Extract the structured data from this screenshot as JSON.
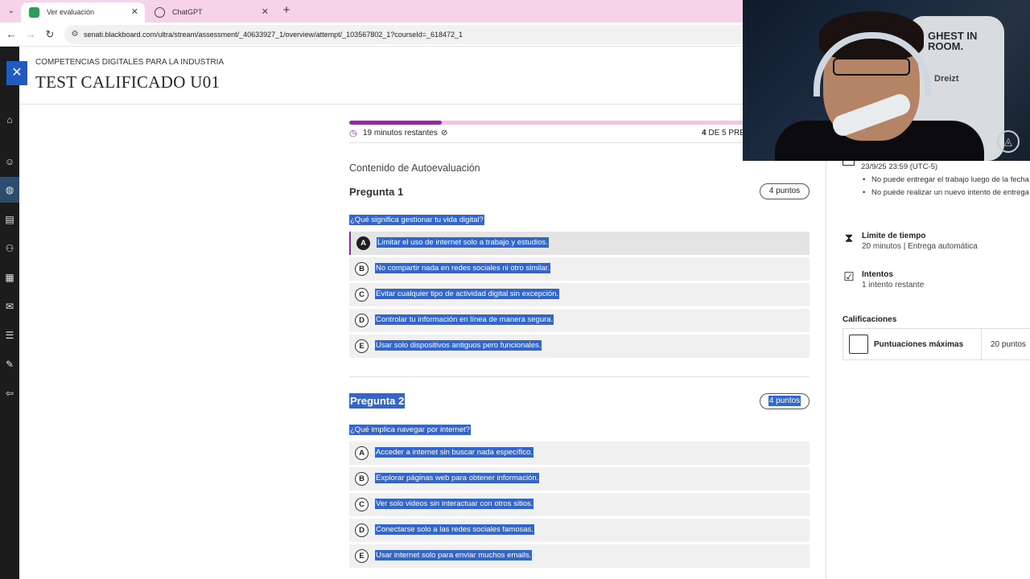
{
  "browser": {
    "tabs": [
      {
        "label": "Ver evaluación",
        "active": true,
        "icon": "blackboard-icon",
        "color": "#2e9c5a"
      },
      {
        "label": "ChatGPT",
        "active": false,
        "icon": "chatgpt-icon",
        "color": "#444444"
      }
    ],
    "url": "senati.blackboard.com/ultra/stream/assessment/_40633927_1/overview/attempt/_103567802_1?courseId=_618472_1"
  },
  "header": {
    "course": "COMPETENCIAS DIGITALES PARA LA INDUSTRIA",
    "title": "TEST CALIFICADO U01"
  },
  "progress": {
    "fraction": 0.225,
    "timer": "19 minutos restantes",
    "current": "4",
    "count_text": " DE 5 PREG"
  },
  "content": {
    "section_title": "Contenido de Autoevaluación",
    "questions": [
      {
        "heading": "Pregunta 1",
        "points": "4 puntos",
        "text": "¿Qué significa gestionar tu vida digital?",
        "options": [
          {
            "letter": "A",
            "text": "Limitar el uso de internet solo a trabajo y estudios."
          },
          {
            "letter": "B",
            "text": "No compartir nada en redes sociales ni otro similar."
          },
          {
            "letter": "C",
            "text": "Evitar cualquier tipo de actividad digital sin excepción."
          },
          {
            "letter": "D",
            "text": "Controlar tu información en línea de manera segura."
          },
          {
            "letter": "E",
            "text": "Usar solo dispositivos antiguos pero funcionales."
          }
        ]
      },
      {
        "heading": "Pregunta 2",
        "points": "4 puntos",
        "text": "¿Qué implica navegar por internet?",
        "options": [
          {
            "letter": "A",
            "text": "Acceder a internet sin buscar nada específico."
          },
          {
            "letter": "B",
            "text": "Explorar páginas web para obtener información."
          },
          {
            "letter": "C",
            "text": "Ver solo videos sin interactuar con otros sitios."
          },
          {
            "letter": "D",
            "text": "Conectarse solo a las redes sociales famosas."
          },
          {
            "letter": "E",
            "text": "Usar internet solo para enviar muchos emails."
          }
        ]
      }
    ]
  },
  "sidebar": {
    "due_date": "23/9/25 23:59 (UTC-5)",
    "notes": [
      "No puede entregar el trabajo luego de la fecha de vencimiento.",
      "No puede realizar un nuevo intento de entrega luego de la fecha de vencimiento."
    ],
    "time_limit_title": "Límite de tiempo",
    "time_limit_value": "20 minutos | Entrega automática",
    "attempts_title": "Intentos",
    "attempts_value": "1 intento restante",
    "grades_title": "Calificaciones",
    "grade_label": "Puntuaciones máximas",
    "grade_value": "20 puntos"
  },
  "webcam": {
    "poster_text": "GHEST IN\nROOM.",
    "chair_brand": "Dreizt"
  },
  "colors": {
    "accent": "#8b2da1",
    "selection": "#3366cc",
    "close_button": "#1f5bc0",
    "tab_strip": "#f6d3e8"
  }
}
